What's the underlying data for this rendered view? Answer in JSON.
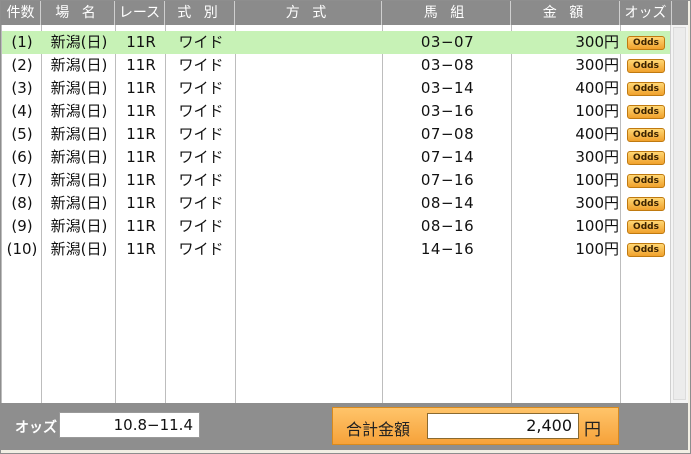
{
  "header": {
    "count": "件数",
    "place": "場 名",
    "race": "レース",
    "type": "式 別",
    "method": "方 式",
    "combo": "馬 組",
    "amount": "金 額",
    "odds": "オッズ"
  },
  "rows": [
    {
      "num": "(1)",
      "place": "新潟(日)",
      "race": "11R",
      "type": "ワイド",
      "method": "",
      "combo": "03−07",
      "amount": "300円",
      "odds_label": "Odds",
      "selected": true
    },
    {
      "num": "(2)",
      "place": "新潟(日)",
      "race": "11R",
      "type": "ワイド",
      "method": "",
      "combo": "03−08",
      "amount": "300円",
      "odds_label": "Odds"
    },
    {
      "num": "(3)",
      "place": "新潟(日)",
      "race": "11R",
      "type": "ワイド",
      "method": "",
      "combo": "03−14",
      "amount": "400円",
      "odds_label": "Odds"
    },
    {
      "num": "(4)",
      "place": "新潟(日)",
      "race": "11R",
      "type": "ワイド",
      "method": "",
      "combo": "03−16",
      "amount": "100円",
      "odds_label": "Odds"
    },
    {
      "num": "(5)",
      "place": "新潟(日)",
      "race": "11R",
      "type": "ワイド",
      "method": "",
      "combo": "07−08",
      "amount": "400円",
      "odds_label": "Odds"
    },
    {
      "num": "(6)",
      "place": "新潟(日)",
      "race": "11R",
      "type": "ワイド",
      "method": "",
      "combo": "07−14",
      "amount": "300円",
      "odds_label": "Odds"
    },
    {
      "num": "(7)",
      "place": "新潟(日)",
      "race": "11R",
      "type": "ワイド",
      "method": "",
      "combo": "07−16",
      "amount": "100円",
      "odds_label": "Odds"
    },
    {
      "num": "(8)",
      "place": "新潟(日)",
      "race": "11R",
      "type": "ワイド",
      "method": "",
      "combo": "08−14",
      "amount": "300円",
      "odds_label": "Odds"
    },
    {
      "num": "(9)",
      "place": "新潟(日)",
      "race": "11R",
      "type": "ワイド",
      "method": "",
      "combo": "08−16",
      "amount": "100円",
      "odds_label": "Odds"
    },
    {
      "num": "(10)",
      "place": "新潟(日)",
      "race": "11R",
      "type": "ワイド",
      "method": "",
      "combo": "14−16",
      "amount": "100円",
      "odds_label": "Odds"
    }
  ],
  "footer": {
    "odds_label": "オッズ",
    "odds_range": "10.8−11.4",
    "total_label": "合計金額",
    "total_value": "2,400",
    "total_unit": "円"
  },
  "colors": {
    "header_bg": "#8b8b8b",
    "selected_row": "#c7f2b6",
    "total_box": "#f6a23a",
    "odds_button": "#f0a12c"
  }
}
